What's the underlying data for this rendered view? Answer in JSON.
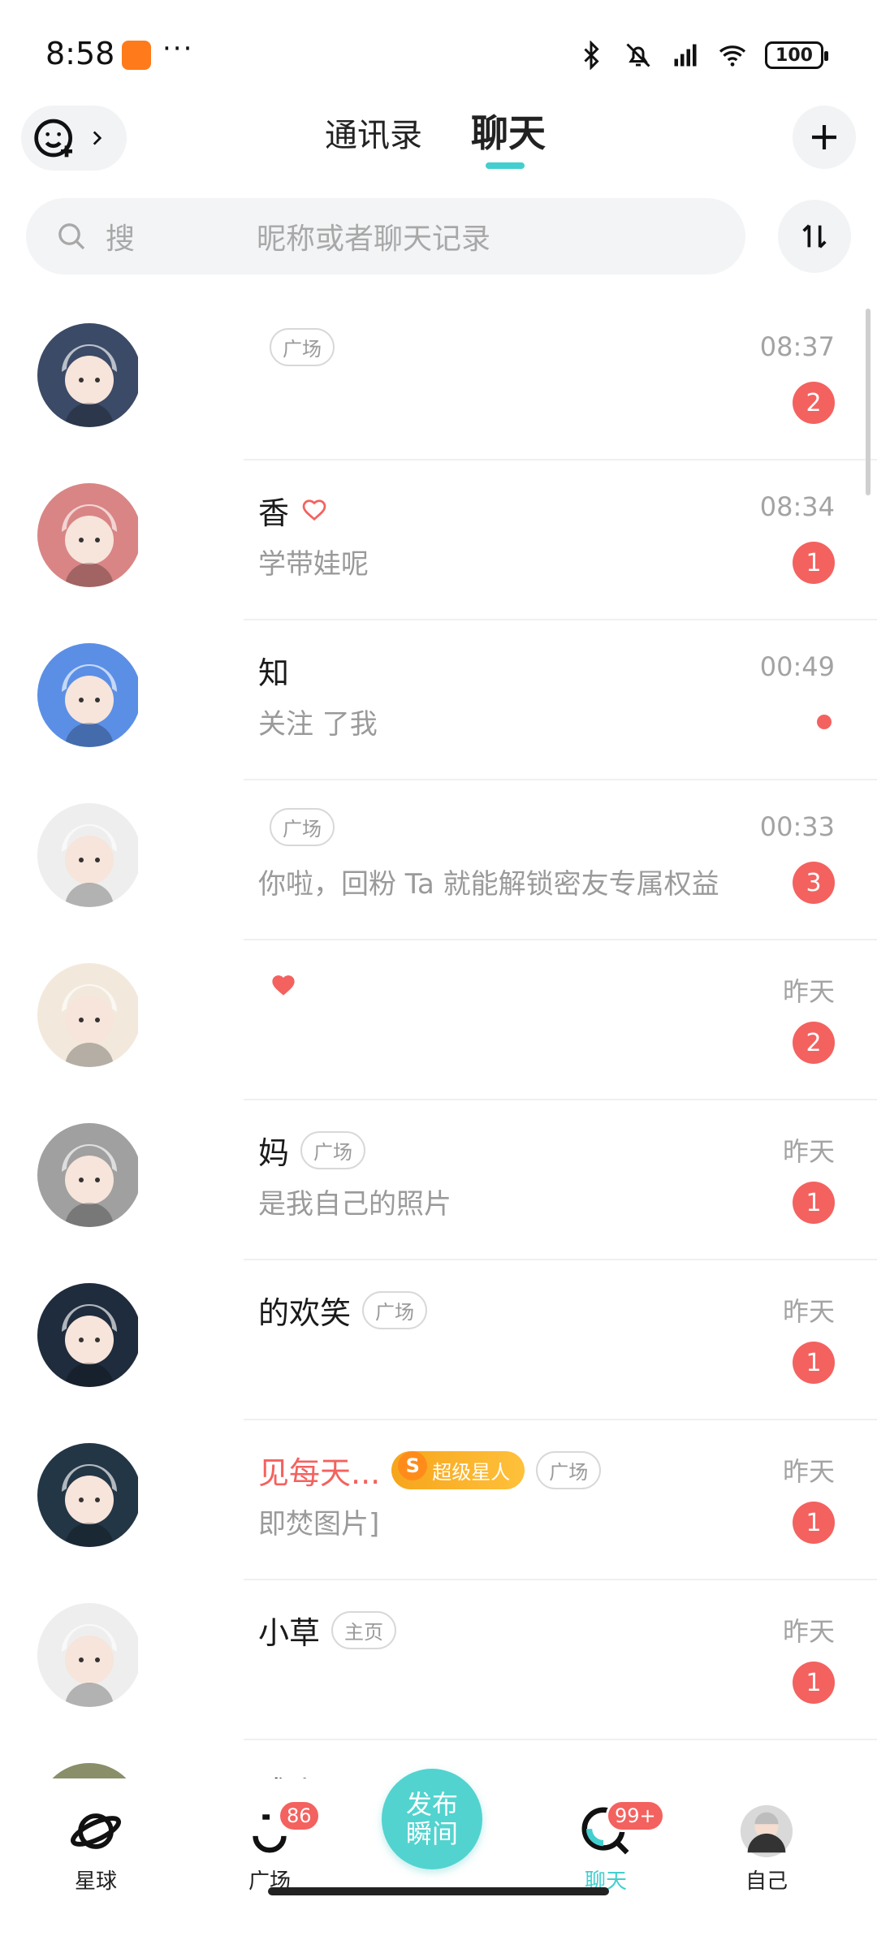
{
  "status_bar": {
    "time": "8:58",
    "dots": "···",
    "battery": "100"
  },
  "header": {
    "tabs": [
      {
        "label": "通讯录",
        "active": false
      },
      {
        "label": "聊天",
        "active": true
      }
    ]
  },
  "search": {
    "placeholder_left": "搜",
    "placeholder": "昵称或者聊天记录"
  },
  "chats": [
    {
      "name": "",
      "tag": "广场",
      "message": "",
      "time": "08:37",
      "badge": "2",
      "avatar_bg": "#3b4a66",
      "heart": false
    },
    {
      "name": "香",
      "tag": "",
      "message": "学带娃呢",
      "time": "08:34",
      "badge": "1",
      "avatar_bg": "#d98585",
      "heart": true
    },
    {
      "name": "知",
      "tag": "",
      "message": "关注 了我",
      "time": "00:49",
      "badge": "",
      "dot": true,
      "avatar_bg": "#5b8fe6",
      "heart": false
    },
    {
      "name": "",
      "tag": "广场",
      "message": "你啦，回粉 Ta 就能解锁密友专属权益",
      "time": "00:33",
      "badge": "3",
      "avatar_bg": "#eeeeee",
      "heart": false
    },
    {
      "name": "",
      "tag": "",
      "message": "",
      "time": "昨天",
      "badge": "2",
      "avatar_bg": "#f2e9dc",
      "heart": true,
      "heart_filled": true
    },
    {
      "name": "妈",
      "tag": "广场",
      "message": "是我自己的照片",
      "time": "昨天",
      "badge": "1",
      "avatar_bg": "#a0a0a0",
      "heart": false
    },
    {
      "name": "的欢笑",
      "tag": "广场",
      "message": "",
      "time": "昨天",
      "badge": "1",
      "avatar_bg": "#1f2c3d",
      "heart": false
    },
    {
      "name": "见每天...",
      "tag": "广场",
      "vip": "超级星人",
      "message": "即焚图片]",
      "time": "昨天",
      "badge": "1",
      "avatar_bg": "#233646",
      "heart": false,
      "name_color": "#f3625f"
    },
    {
      "name": "小草",
      "tag": "主页",
      "message": "",
      "time": "昨天",
      "badge": "1",
      "avatar_bg": "#eeeeee",
      "heart": false
    },
    {
      "name": "成小",
      "tag": "",
      "message": "",
      "time": "昨天",
      "badge": "",
      "avatar_bg": "#8a8f6a",
      "heart": false
    }
  ],
  "bottom_nav": {
    "items": [
      {
        "label": "星球",
        "badge": ""
      },
      {
        "label": "广场",
        "badge": "86"
      },
      {
        "label": "聊天",
        "badge": "99+"
      },
      {
        "label": "自己",
        "badge": ""
      }
    ],
    "publish_line1": "发布",
    "publish_line2": "瞬间"
  },
  "colors": {
    "accent": "#43cfcf",
    "badge": "#f3625f"
  }
}
